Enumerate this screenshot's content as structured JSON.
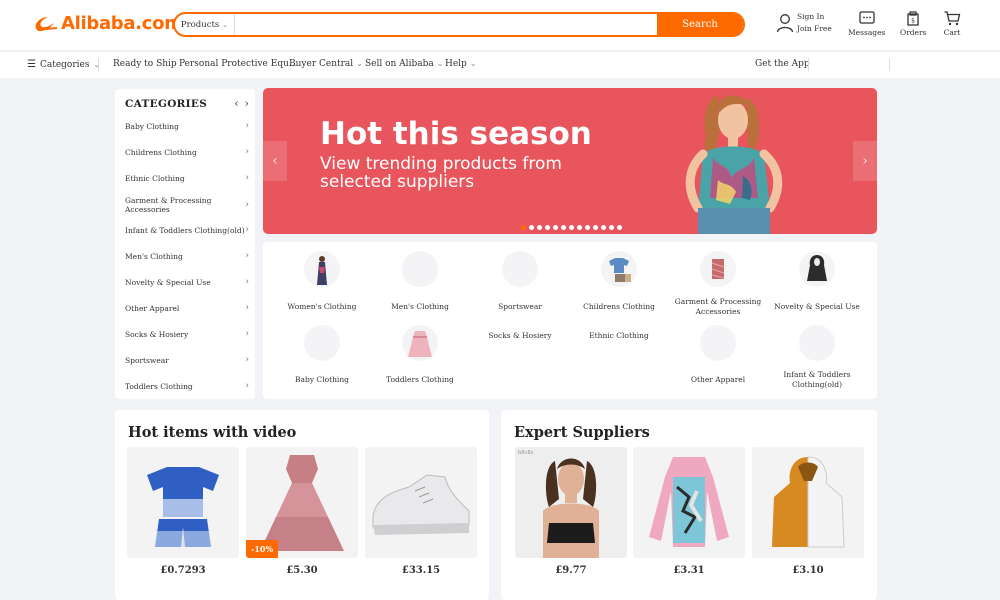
{
  "brand": {
    "name": "Alibaba.com",
    "accent": "#ff6a00"
  },
  "search": {
    "category": "Products",
    "placeholder": "",
    "button": "Search"
  },
  "header": {
    "signin": "Sign In",
    "join": "Join Free",
    "messages": "Messages",
    "orders": "Orders",
    "cart": "Cart"
  },
  "subnav": {
    "categories": "Categories",
    "ready": "Ready to Ship",
    "ppe": "Personal Protective Equ...",
    "buyer": "Buyer Central",
    "sell": "Sell on Alibaba",
    "help": "Help",
    "app": "Get the App"
  },
  "sidebar": {
    "title": "CATEGORIES",
    "items": [
      "Baby Clothing",
      "Childrens Clothing",
      "Ethnic Clothing",
      "Garment & Processing Accessories",
      "Infant & Toddlers Clothing(old)",
      "Men's Clothing",
      "Novelty & Special Use",
      "Other Apparel",
      "Socks & Hosiery",
      "Sportswear",
      "Toddlers Clothing"
    ]
  },
  "banner": {
    "title": "Hot this season",
    "subtitle": "View trending products from selected suppliers",
    "slides": 13,
    "active_slide": 1
  },
  "category_grid": [
    "Women's Clothing",
    "Men's Clothing",
    "Sportswear",
    "Childrens Clothing",
    "Garment & Processing Accessories",
    "Novelty & Special Use",
    "Baby Clothing",
    "Toddlers Clothing",
    "Socks & Hosiery",
    "Ethnic Clothing",
    "Other Apparel",
    "Infant & Toddlers Clothing(old)"
  ],
  "hot_items": {
    "title": "Hot items with video",
    "products": [
      {
        "price": "£0.7293",
        "badge": ""
      },
      {
        "price": "£5.30",
        "badge": "-10%"
      },
      {
        "price": "£33.15",
        "badge": ""
      }
    ]
  },
  "expert": {
    "title": "Expert Suppliers",
    "tiny_label": "b8n8s",
    "products": [
      {
        "price": "£9.77"
      },
      {
        "price": "£3.31"
      },
      {
        "price": "£3.10"
      }
    ]
  }
}
